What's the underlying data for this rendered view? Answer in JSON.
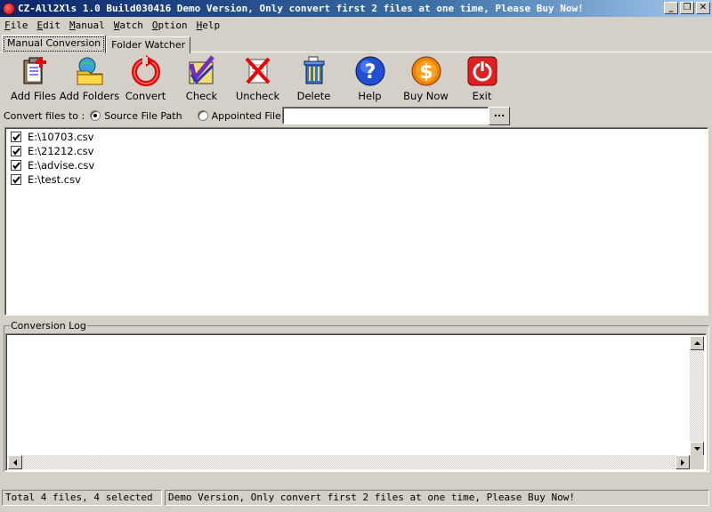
{
  "window": {
    "title": "CZ-All2Xls 1.0 Build030416 Demo Version, Only convert first 2 files at one time, Please Buy Now!"
  },
  "menu": [
    {
      "label": "File",
      "accel": "F",
      "rest": "ile"
    },
    {
      "label": "Edit",
      "accel": "E",
      "rest": "dit"
    },
    {
      "label": "Manual",
      "accel": "M",
      "rest": "anual"
    },
    {
      "label": "Watch",
      "accel": "W",
      "rest": "atch"
    },
    {
      "label": "Option",
      "accel": "O",
      "rest": "ption"
    },
    {
      "label": "Help",
      "accel": "H",
      "rest": "elp"
    }
  ],
  "tabs": [
    {
      "label": "Manual Conversion",
      "active": true
    },
    {
      "label": "Folder Watcher",
      "active": false
    }
  ],
  "toolbar": [
    {
      "label": "Add Files",
      "icon": "add-files-icon"
    },
    {
      "label": "Add Folders",
      "icon": "add-folders-icon"
    },
    {
      "label": "Convert",
      "icon": "convert-icon"
    },
    {
      "label": "Check",
      "icon": "check-icon"
    },
    {
      "label": "Uncheck",
      "icon": "uncheck-icon"
    },
    {
      "label": "Delete",
      "icon": "delete-icon"
    },
    {
      "label": "Help",
      "icon": "help-icon"
    },
    {
      "label": "Buy Now",
      "icon": "buy-now-icon"
    },
    {
      "label": "Exit",
      "icon": "exit-icon"
    }
  ],
  "convert_to": {
    "label": "Convert files to :",
    "option_source": "Source File Path",
    "option_appointed": "Appointed File  Path",
    "selected": "source",
    "path_value": "",
    "browse_label": "..."
  },
  "files": [
    {
      "name": "E:\\10703.csv",
      "checked": true
    },
    {
      "name": "E:\\21212.csv",
      "checked": true
    },
    {
      "name": "E:\\advise.csv",
      "checked": true
    },
    {
      "name": "E:\\test.csv",
      "checked": true
    }
  ],
  "log": {
    "legend": "Conversion Log",
    "content": ""
  },
  "status": {
    "left": "Total 4 files, 4 selected",
    "right": "Demo Version, Only convert first 2 files at one time, Please Buy Now!"
  }
}
